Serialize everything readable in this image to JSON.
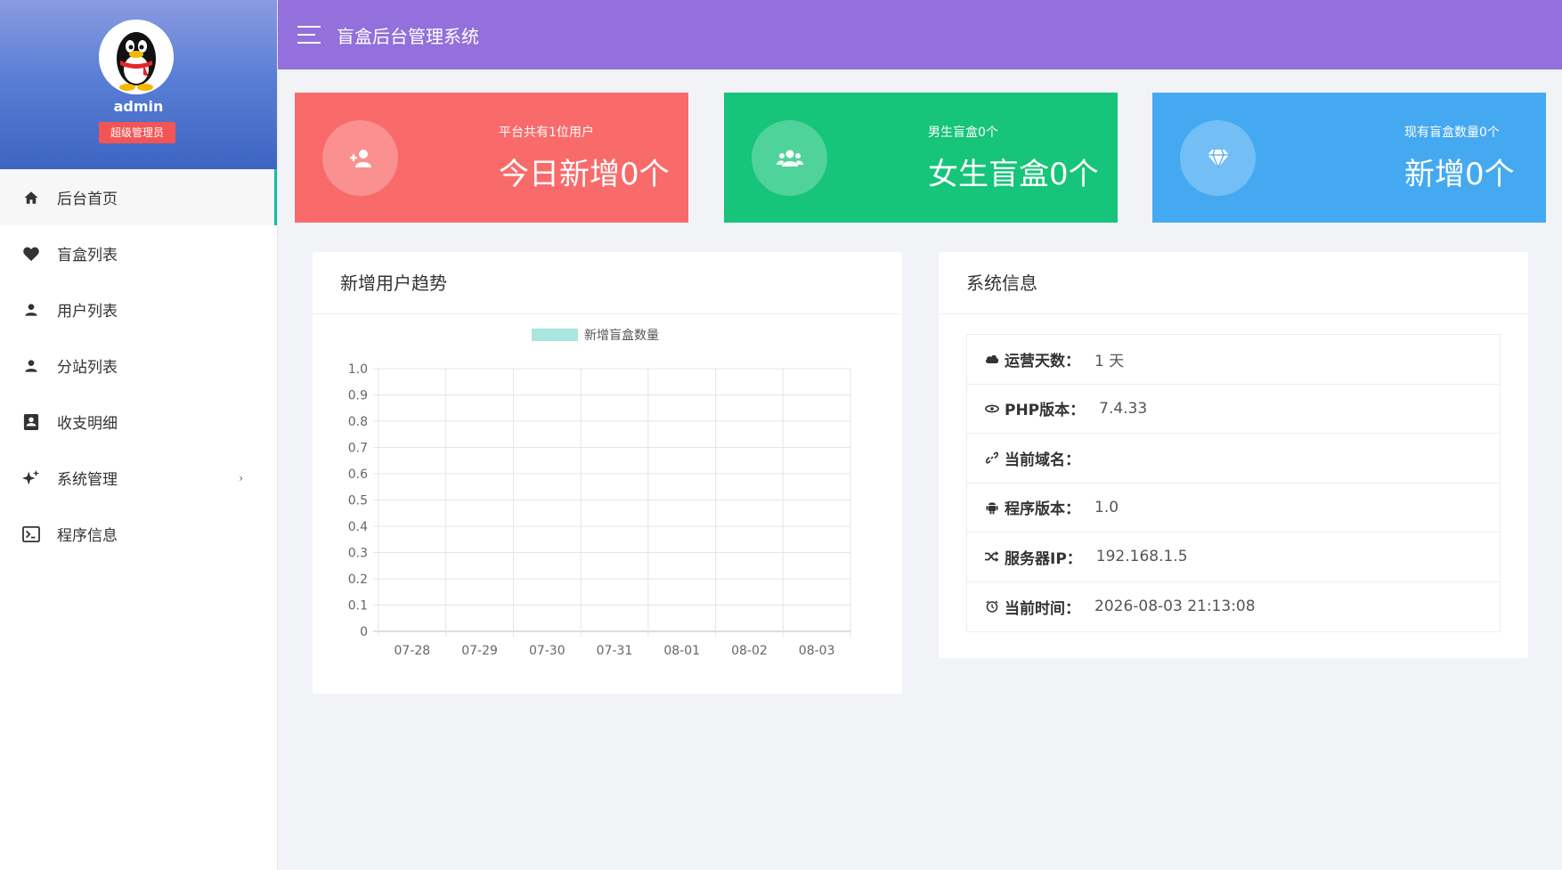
{
  "sidebar": {
    "profile": {
      "name": "admin",
      "role": "超级管理员"
    },
    "items": [
      {
        "label": "后台首页",
        "icon": "home-icon",
        "active": true
      },
      {
        "label": "盲盒列表",
        "icon": "heart-icon"
      },
      {
        "label": "用户列表",
        "icon": "user-icon"
      },
      {
        "label": "分站列表",
        "icon": "user-icon"
      },
      {
        "label": "收支明细",
        "icon": "contacts-icon"
      },
      {
        "label": "系统管理",
        "icon": "sparkle-icon",
        "has_submenu": true,
        "arrow": "›"
      },
      {
        "label": "程序信息",
        "icon": "terminal-icon"
      }
    ]
  },
  "header": {
    "title": "盲盒后台管理系统"
  },
  "stats": [
    {
      "subtitle": "平台共有1位用户",
      "value": "今日新增0个",
      "icon": "user-add-icon",
      "color": "#f96b6b"
    },
    {
      "subtitle": "男生盲盒0个",
      "value": "女生盲盒0个",
      "icon": "users-icon",
      "color": "#16c47a"
    },
    {
      "subtitle": "现有盲盒数量0个",
      "value": "新增0个",
      "icon": "diamond-icon",
      "color": "#45a9f1"
    }
  ],
  "trend_panel": {
    "title": "新增用户趋势"
  },
  "chart_data": {
    "type": "bar",
    "categories": [
      "07-28",
      "07-29",
      "07-30",
      "07-31",
      "08-01",
      "08-02",
      "08-03"
    ],
    "series": [
      {
        "name": "新增盲盒数量",
        "values": [
          0,
          0,
          0,
          0,
          0,
          0,
          0
        ],
        "color": "#a8e6df"
      }
    ],
    "yticks": [
      "0",
      "0.1",
      "0.2",
      "0.3",
      "0.4",
      "0.5",
      "0.6",
      "0.7",
      "0.8",
      "0.9",
      "1.0"
    ],
    "ylim": [
      0,
      1
    ],
    "grid": true,
    "legend": "top-center"
  },
  "info_panel": {
    "title": "系统信息",
    "rows": [
      {
        "label": "运营天数：",
        "value": "1 天",
        "icon": "cloud-icon"
      },
      {
        "label": "PHP版本：",
        "value": "7.4.33",
        "icon": "eye-icon"
      },
      {
        "label": "当前域名：",
        "value": "",
        "icon": "link-icon"
      },
      {
        "label": "程序版本：",
        "value": "1.0",
        "icon": "android-icon"
      },
      {
        "label": "服务器IP：",
        "value": "192.168.1.5",
        "icon": "shuffle-icon"
      },
      {
        "label": "当前时间：",
        "value": "2026-08-03 21:13:08",
        "icon": "alarm-icon"
      }
    ]
  }
}
